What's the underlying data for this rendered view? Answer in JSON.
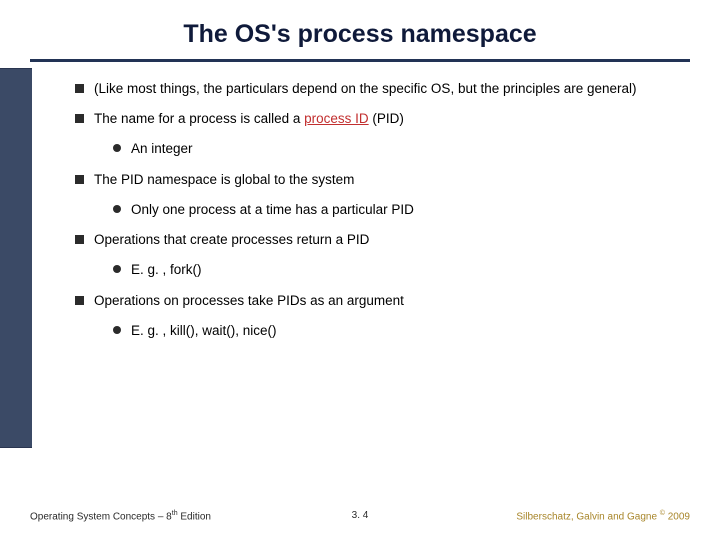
{
  "title": "The OS's process namespace",
  "bullets": {
    "b1": "(Like most things, the particulars depend on the specific OS, but the principles are general)",
    "b2_pre": "The name for a process is called a ",
    "b2_hl": "process ID",
    "b2_post": " (PID)",
    "b2_1": "An integer",
    "b3": "The PID namespace is global to the system",
    "b3_1": "Only one process at a time has a particular PID",
    "b4": "Operations that create processes return a PID",
    "b4_1": "E. g. , fork()",
    "b5": "Operations on processes take PIDs as an argument",
    "b5_1": "E. g. , kill(), wait(), nice()"
  },
  "footer": {
    "left_pre": "Operating System Concepts – 8",
    "left_sup": "th",
    "left_post": " Edition",
    "center": "3. 4",
    "right_pre": "Silberschatz, Galvin and Gagne ",
    "right_sup": "©",
    "right_post": " 2009"
  }
}
